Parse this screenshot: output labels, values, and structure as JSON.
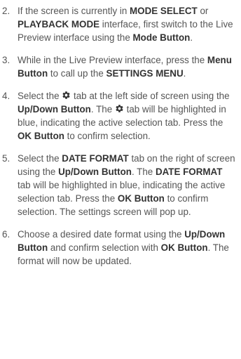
{
  "steps": [
    {
      "num": "2.",
      "segments": [
        {
          "t": "If the screen is currently in "
        },
        {
          "t": "MODE SELECT",
          "b": true
        },
        {
          "t": " or "
        },
        {
          "t": "PLAYBACK MODE",
          "b": true
        },
        {
          "t": " interface, first switch to the Live Preview interface using the "
        },
        {
          "t": "Mode Button",
          "b": true
        },
        {
          "t": "."
        }
      ]
    },
    {
      "num": "3.",
      "segments": [
        {
          "t": "While in the Live Preview interface, press the "
        },
        {
          "t": "Menu Button",
          "b": true
        },
        {
          "t": " to call up the "
        },
        {
          "t": "SETTINGS MENU",
          "b": true
        },
        {
          "t": "."
        }
      ]
    },
    {
      "num": "4.",
      "segments": [
        {
          "t": "Select the "
        },
        {
          "icon": "gear-icon"
        },
        {
          "t": " tab at the left side of screen using the "
        },
        {
          "t": "Up/Down Button",
          "b": true
        },
        {
          "t": ". The "
        },
        {
          "icon": "gear-icon"
        },
        {
          "t": " tab will be highlighted in blue, indicating the active selection tab. Press the "
        },
        {
          "t": "OK Button",
          "b": true
        },
        {
          "t": " to confirm selection."
        }
      ]
    },
    {
      "num": "5.",
      "segments": [
        {
          "t": "Select the "
        },
        {
          "t": "DATE FORMAT",
          "b": true
        },
        {
          "t": " tab on the right of screen using the "
        },
        {
          "t": "Up/Down Button",
          "b": true
        },
        {
          "t": ". The "
        },
        {
          "t": "DATE FORMAT",
          "b": true
        },
        {
          "t": " tab will be highlighted in blue, indicating the active selection tab. Press the "
        },
        {
          "t": "OK Button",
          "b": true
        },
        {
          "t": " to confirm selection. The settings screen will pop up."
        }
      ]
    },
    {
      "num": "6.",
      "segments": [
        {
          "t": "Choose a desired date format using the "
        },
        {
          "t": "Up/Down Button",
          "b": true
        },
        {
          "t": " and confirm selection with "
        },
        {
          "t": "OK Button",
          "b": true
        },
        {
          "t": ". The format will now be updated."
        }
      ]
    }
  ]
}
